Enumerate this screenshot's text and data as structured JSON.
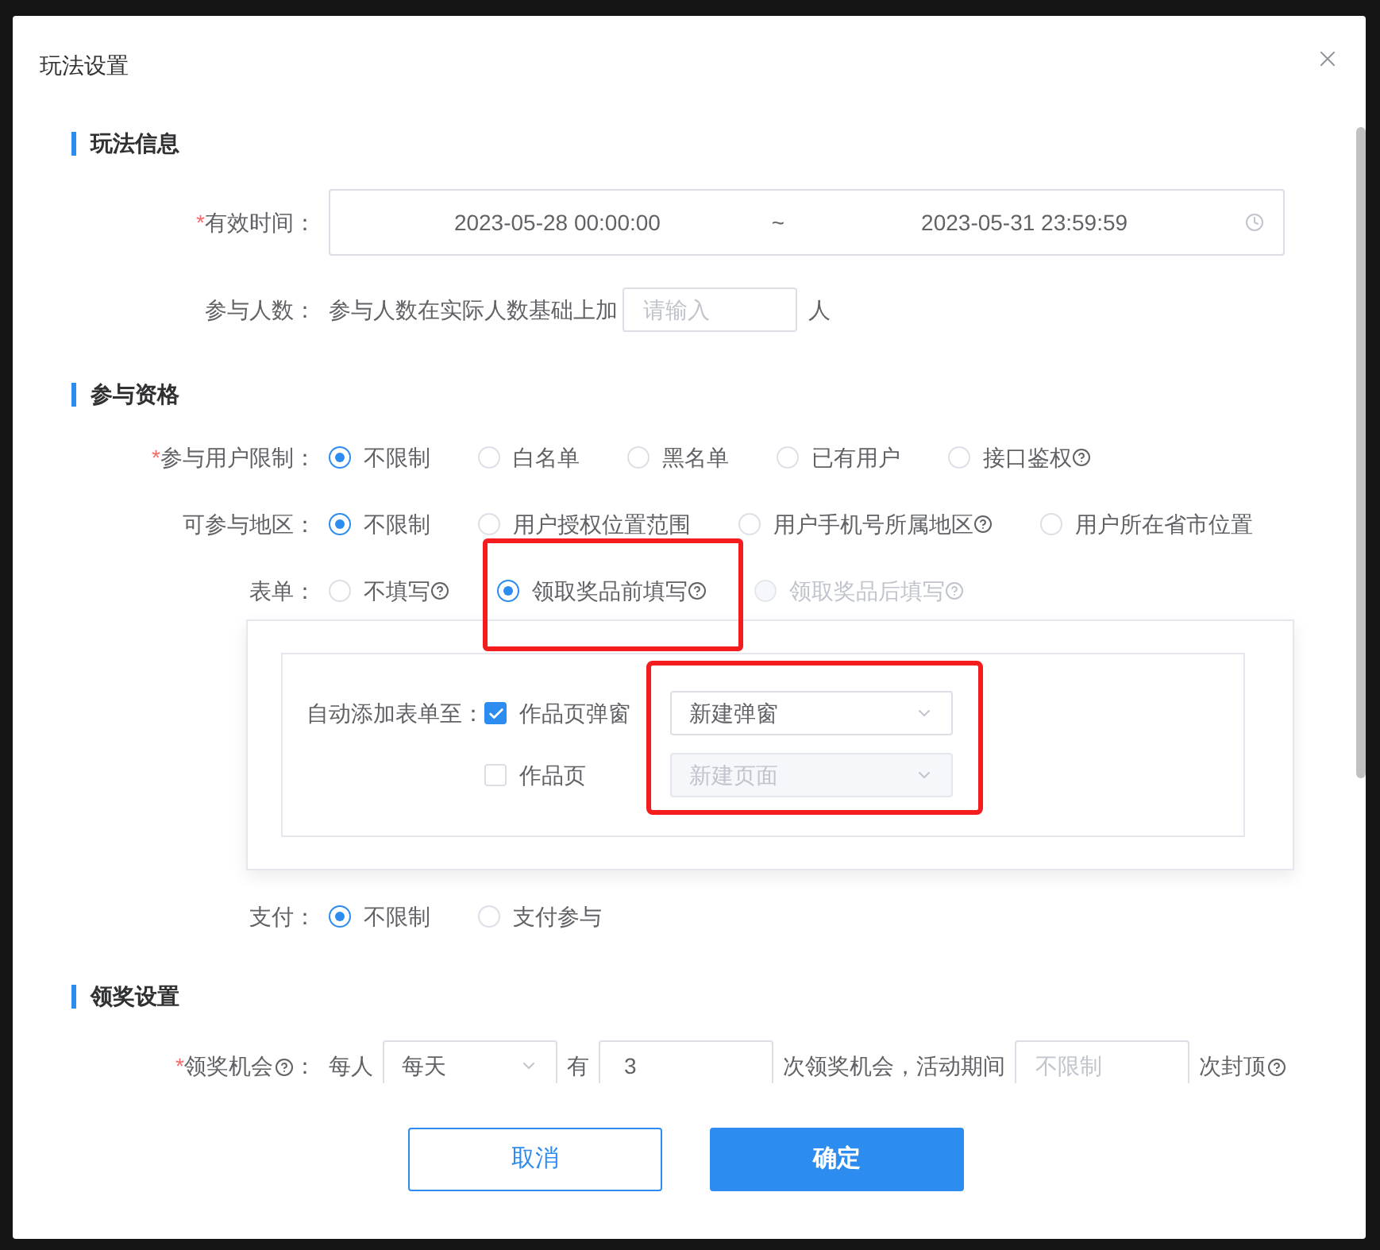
{
  "title": "玩法设置",
  "sections": [
    {
      "heading": "玩法信息",
      "rows": [
        {
          "kind": "daterange",
          "label": "有效时间：",
          "required_mark": "*",
          "start": "2023-05-28 00:00:00",
          "separator": "~",
          "end": "2023-05-31 23:59:59"
        },
        {
          "kind": "number",
          "label": "参与人数：",
          "prefix": "参与人数在实际人数基础上加",
          "placeholder": "请输入",
          "suffix": "人"
        }
      ]
    },
    {
      "heading": "参与资格",
      "rows": [
        {
          "kind": "radio",
          "label": "参与用户限制：",
          "required_mark": "*",
          "options": [
            {
              "label": "不限制",
              "selected": true,
              "help": false,
              "disabled": false,
              "highlighted": false
            },
            {
              "label": "白名单",
              "selected": false,
              "help": false,
              "disabled": false,
              "highlighted": false
            },
            {
              "label": "黑名单",
              "selected": false,
              "help": false,
              "disabled": false,
              "highlighted": false
            },
            {
              "label": "已有用户",
              "selected": false,
              "help": false,
              "disabled": false,
              "highlighted": false
            },
            {
              "label": "接口鉴权",
              "selected": false,
              "help": true,
              "disabled": false,
              "highlighted": false
            }
          ]
        },
        {
          "kind": "radio",
          "label": "可参与地区：",
          "options": [
            {
              "label": "不限制",
              "selected": true,
              "help": false,
              "disabled": false,
              "highlighted": false
            },
            {
              "label": "用户授权位置范围",
              "selected": false,
              "help": false,
              "disabled": false,
              "highlighted": false
            },
            {
              "label": "用户手机号所属地区",
              "selected": false,
              "help": true,
              "disabled": false,
              "highlighted": false
            },
            {
              "label": "用户所在省市位置",
              "selected": false,
              "help": false,
              "disabled": false,
              "highlighted": false
            }
          ]
        },
        {
          "kind": "radio",
          "label": "表单：",
          "options": [
            {
              "label": "不填写",
              "selected": false,
              "help": true,
              "disabled": false,
              "highlighted": false
            },
            {
              "label": "领取奖品前填写",
              "selected": true,
              "help": true,
              "disabled": false,
              "highlighted": true
            },
            {
              "label": "领取奖品后填写",
              "selected": false,
              "help": true,
              "disabled": true,
              "highlighted": false
            }
          ]
        },
        {
          "kind": "form_panel",
          "label": "自动添加表单至：",
          "highlighted": true,
          "items": [
            {
              "label": "作品页弹窗",
              "checked": true,
              "select": {
                "value": "新建弹窗",
                "disabled": false
              }
            },
            {
              "label": "作品页",
              "checked": false,
              "select": {
                "placeholder": "新建页面",
                "disabled": true
              }
            }
          ]
        },
        {
          "kind": "radio",
          "label": "支付：",
          "options": [
            {
              "label": "不限制",
              "selected": true,
              "help": false,
              "disabled": false
            },
            {
              "label": "支付参与",
              "selected": false,
              "help": false,
              "disabled": false
            }
          ]
        }
      ]
    },
    {
      "heading": "领奖设置",
      "rows": [
        {
          "kind": "prize",
          "label": "领奖机会",
          "help": true,
          "required_mark": "*",
          "colon": "：",
          "per": "每人",
          "period": "每天",
          "has": "有",
          "count": "3",
          "middle": "次领奖机会，活动期间",
          "cap_placeholder": "不限制",
          "suffix": "次封顶",
          "suffix_help": true
        }
      ]
    }
  ],
  "buttons": [
    {
      "label": "取消",
      "primary": false
    },
    {
      "label": "确定",
      "primary": true
    }
  ]
}
